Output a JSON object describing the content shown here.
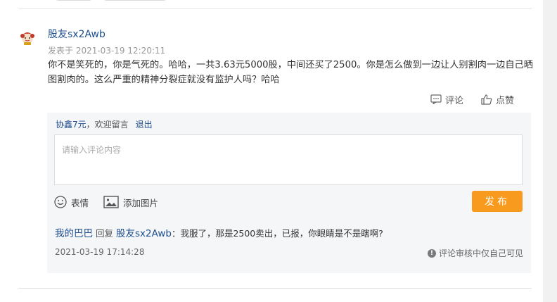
{
  "post": {
    "username": "股友sx2Awb",
    "posted_time": "发表于 2021-03-19 12:20:11",
    "content": "你不是笑死的，你是气死的。哈哈，一共3.63元5000股，中间还买了2500。你是怎么做到一边让人别割肉一边自己晒图割肉的。这么严重的精神分裂症就没有监护人吗？哈哈",
    "actions": {
      "comment": "评论",
      "like": "点赞"
    }
  },
  "reply_panel": {
    "login_nick": "协鑫7元",
    "welcome_text": "，欢迎留言",
    "logout_label": "退出",
    "comment_placeholder": "请输入评论内容",
    "emoji_label": "表情",
    "image_label": "添加图片",
    "publish_label": "发布",
    "publish_color": "#f79a1e"
  },
  "reply": {
    "author": "我的巴巴",
    "verb": "回复",
    "target": "股友sx2Awb",
    "text": "：我服了，那是2500卖出，已报，你眼睛是不是瞎啊?",
    "time": "2021-03-19 17:14:28",
    "note": "评论审核中仅自己可见"
  },
  "colors": {
    "link": "#1f4e8c",
    "accent": "#f79a1e",
    "panel_bg": "#f5f6f8"
  },
  "icons": [
    "avatar",
    "comment-icon",
    "thumbs-up-icon",
    "emoji-icon",
    "image-icon",
    "info-icon"
  ]
}
